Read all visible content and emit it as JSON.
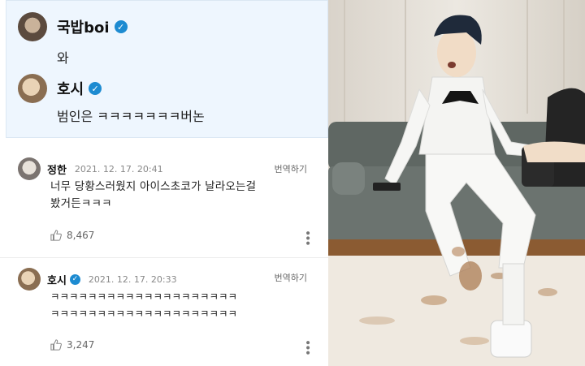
{
  "quote": {
    "user1": {
      "name": "국밥boi",
      "text": "와"
    },
    "user2": {
      "name": "호시",
      "text": "범인은 ㅋㅋㅋㅋㅋㅋㅋ버논"
    }
  },
  "comments": [
    {
      "name": "정한",
      "date": "2021. 12. 17. 20:41",
      "translate": "번역하기",
      "line1": "너무 당황스러웠지 아이스초코가 날라오는걸",
      "line2": "봤거든ㅋㅋㅋ",
      "likes": "8,467"
    },
    {
      "name": "호시",
      "date": "2021. 12. 17. 20:33",
      "translate": "번역하기",
      "line1": "ㅋㅋㅋㅋㅋㅋㅋㅋㅋㅋㅋㅋㅋㅋㅋㅋㅋㅋㅋㅋ",
      "line2": "ㅋㅋㅋㅋㅋㅋㅋㅋㅋㅋㅋㅋㅋㅋㅋㅋㅋㅋㅋㅋ",
      "likes": "3,247"
    }
  ],
  "colors": {
    "verified": "#1d8bd1",
    "quote_bg": "#eef6fe",
    "sofa": "#5c6460"
  }
}
